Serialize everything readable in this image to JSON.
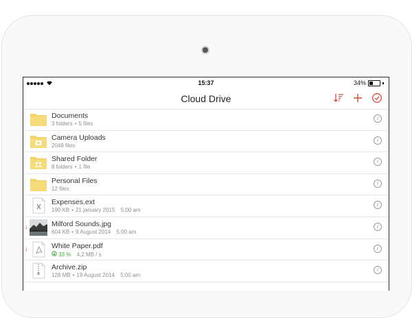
{
  "status_bar": {
    "time": "15:37",
    "battery": "34%",
    "battery_level": 0.34
  },
  "nav": {
    "title": "Cloud Drive",
    "icons": [
      "sort-icon",
      "add-icon",
      "select-icon"
    ]
  },
  "colors": {
    "accent": "#d64a3a",
    "folder": "#f3d36c",
    "progress": "#46a346"
  },
  "files": [
    {
      "name": "Documents",
      "meta_a": "3 folders",
      "meta_b": "5 files",
      "kind": "folder",
      "icon": "folder-icon"
    },
    {
      "name": "Camera Uploads",
      "meta_a": "2048 files",
      "kind": "folder",
      "icon": "camera-folder-icon"
    },
    {
      "name": "Shared Folder",
      "meta_a": "8 folders",
      "meta_b": "1 file",
      "kind": "folder",
      "icon": "shared-folder-icon"
    },
    {
      "name": "Personal Files",
      "meta_a": "12 files",
      "kind": "folder",
      "icon": "folder-icon"
    },
    {
      "name": "Expenses.ext",
      "meta_a": "190 KB",
      "meta_b": "21 january 2015",
      "meta_c": "5:00 am",
      "kind": "spreadsheet",
      "icon": "spreadsheet-file-icon"
    },
    {
      "name": "Milford Sounds.jpg",
      "meta_a": "604 KB",
      "meta_b": "9 August 2014",
      "meta_c": "5:00 am",
      "kind": "image",
      "icon": "image-thumbnail",
      "downloading": true
    },
    {
      "name": "White Paper.pdf",
      "progress": "33 %",
      "progress_value": 0.33,
      "speed": "4,2 MB / s",
      "kind": "pdf",
      "icon": "pdf-file-icon",
      "downloading": true
    },
    {
      "name": "Archive.zip",
      "meta_a": "128 MB",
      "meta_b": "19 August 2014",
      "meta_c": "5:00 am",
      "kind": "zip",
      "icon": "zip-file-icon"
    }
  ]
}
